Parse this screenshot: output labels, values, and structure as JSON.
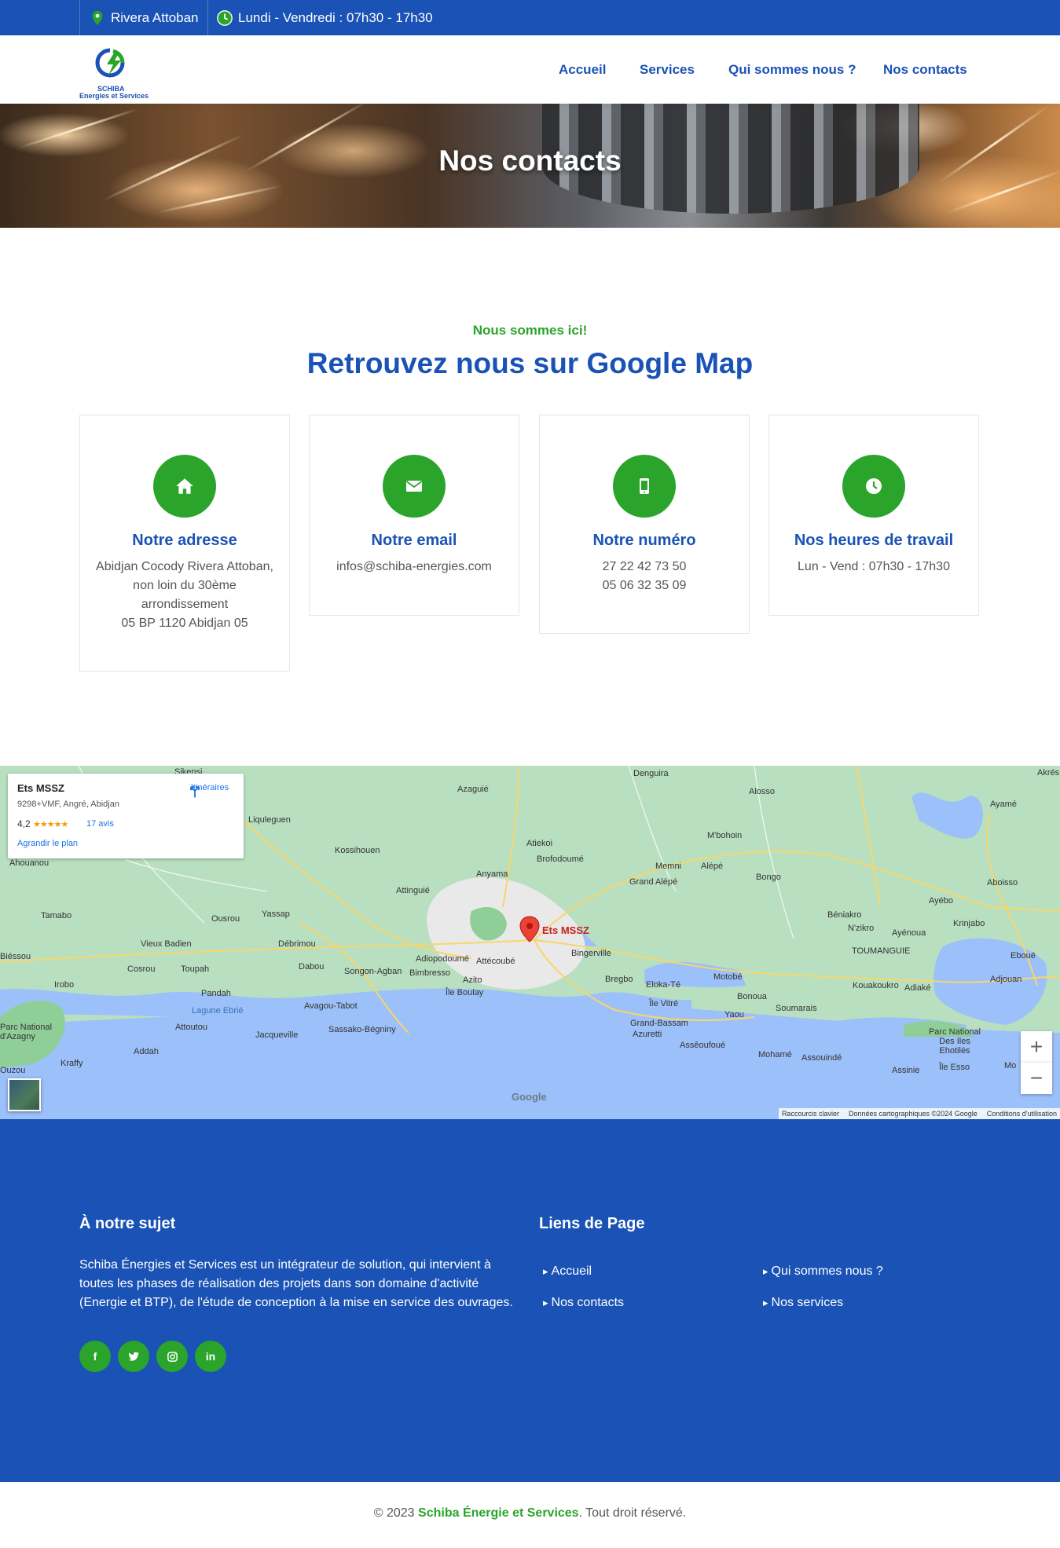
{
  "topbar": {
    "location": "Rivera Attoban",
    "hours": "Lundi - Vendredi : 07h30 - 17h30"
  },
  "logo": {
    "line1": "SCHIBA",
    "line2": "Energies et Services"
  },
  "nav": {
    "home": "Accueil",
    "services": "Services",
    "about": "Qui sommes nous ?",
    "contacts": "Nos contacts"
  },
  "hero": {
    "title": "Nos contacts"
  },
  "section": {
    "kicker": "Nous sommes ici!",
    "title": "Retrouvez nous sur Google Map"
  },
  "cards": [
    {
      "title": "Notre adresse",
      "lines": [
        "Abidjan Cocody Rivera Attoban, non loin du 30ème arrondissement",
        "05 BP 1120 Abidjan 05"
      ],
      "icon": "home-icon"
    },
    {
      "title": "Notre email",
      "lines": [
        "infos@schiba-energies.com"
      ],
      "icon": "envelope-icon"
    },
    {
      "title": "Notre numéro",
      "lines": [
        "27 22 42 73 50",
        "05 06 32 35 09"
      ],
      "icon": "mobile-icon"
    },
    {
      "title": "Nos heures de travail",
      "lines": [
        "Lun - Vend : 07h30 - 17h30"
      ],
      "icon": "clock-icon"
    }
  ],
  "map": {
    "place_name": "Ets MSSZ",
    "address": "9298+VMF, Angré, Abidjan",
    "rating": "4,2",
    "stars": "★★★★★",
    "reviews": "17 avis",
    "enlarge": "Agrandir le plan",
    "directions": "Itinéraires",
    "pin_label": "Ets MSSZ",
    "google": "Google",
    "attribution": [
      "Raccourcis clavier",
      "Données cartographiques ©2024 Google",
      "Conditions d'utilisation"
    ],
    "zoom_in": "+",
    "zoom_out": "−",
    "places": [
      "Sikensi",
      "Azaguié",
      "Denguira",
      "Alosso",
      "Akrés",
      "Liquleguen",
      "M'bohoin",
      "Ayamé",
      "Ahouanou",
      "Kossihouen",
      "Atiekoi",
      "Brofodoumé",
      "Memni",
      "Alépé",
      "Bongo",
      "Aboisso",
      "Anyama",
      "Grand Alépé",
      "Tamabo",
      "Attinguié",
      "Ayébo",
      "Béniakro",
      "N'zikro",
      "Krinjabo",
      "Ousrou",
      "Yassap",
      "Ayénoua",
      "Vieux Badien",
      "Débrimou",
      "TOUMANGUIE",
      "Eboué",
      "Bingerville",
      "Adiopodoumé",
      "Attécoubé",
      "Cosrou",
      "Toupah",
      "Dabou",
      "Songon-Agban",
      "Bimbresso",
      "Azito",
      "Bregbo",
      "Eloka-Té",
      "Motobé",
      "Kouakoukro",
      "Adiaké",
      "Adjouan",
      "Irobo",
      "Pandah",
      "Île Boulay",
      "Bonoua",
      "Avagou-Tabot",
      "Lagune Ebrié",
      "Île Vitré",
      "Soumarais",
      "Attoutou",
      "Yaou",
      "Sassako-Bégniny",
      "Grand-Bassam",
      "Jacqueville",
      "Azuretti",
      "Assêoufoué",
      "Addah",
      "Mohamé",
      "Assouindé",
      "Kraffy",
      "Assinie",
      "Parc National d'Azagny",
      "Parc National Des Iles Ehotilés",
      "Île Esso",
      "Biéssou",
      "Ouzou",
      "Mo"
    ]
  },
  "footer": {
    "about_title": "À notre sujet",
    "about_text": "Schiba Énergies et Services est un intégrateur de solution, qui intervient à toutes les phases de réalisation des projets dans son domaine d'activité (Energie et BTP), de l'étude de conception à la mise en service des ouvrages.",
    "links_title": "Liens de Page",
    "links": [
      "Accueil",
      "Qui sommes nous ?",
      "Nos contacts",
      "Nos services"
    ],
    "social": [
      "f",
      "t",
      "ig",
      "in"
    ]
  },
  "copyright": {
    "prefix": "© 2023",
    "company": "Schiba Énergie et Services",
    "suffix": ". Tout droit réservé."
  },
  "colors": {
    "primary": "#1a52b5",
    "accent": "#2aa42a"
  }
}
